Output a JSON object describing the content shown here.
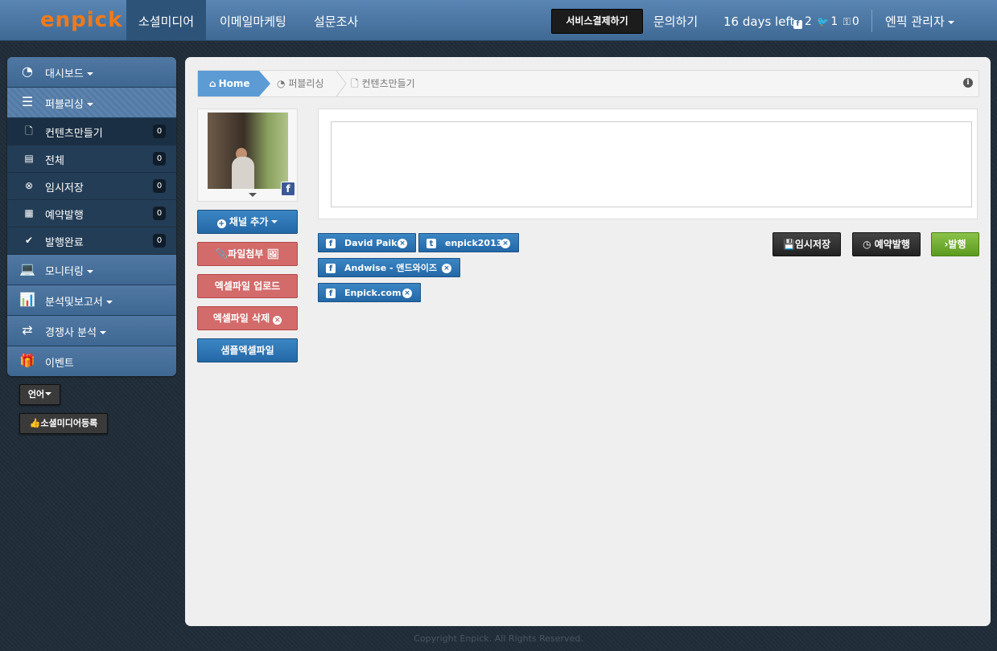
{
  "brand": {
    "logo_text": "enpick"
  },
  "topnav": {
    "tabs": [
      {
        "label": "소셜미디어",
        "active": true
      },
      {
        "label": "이메일마케팅",
        "active": false
      },
      {
        "label": "설문조사",
        "active": false
      }
    ],
    "pay_button": "서비스결제하기",
    "contact_link": "문의하기",
    "days_left": "16 days left",
    "stats": {
      "facebook": "2",
      "twitter": "1",
      "key": "0"
    },
    "user_menu": "엔픽 관리자"
  },
  "sidebar": {
    "items": [
      {
        "label": "대시보드",
        "icon": "dashboard-icon",
        "dropdown": true
      },
      {
        "label": "퍼블리싱",
        "icon": "list-icon",
        "dropdown": true,
        "open": true
      },
      {
        "label": "모니터링",
        "icon": "laptop-icon",
        "dropdown": true
      },
      {
        "label": "분석및보고서",
        "icon": "bar-chart-icon",
        "dropdown": true
      },
      {
        "label": "경쟁사 분석",
        "icon": "exchange-icon",
        "dropdown": true
      },
      {
        "label": "이벤트",
        "icon": "gift-icon",
        "dropdown": false
      }
    ],
    "subitems": [
      {
        "label": "컨텐츠만들기",
        "count": "0",
        "icon": "file-icon",
        "active": true
      },
      {
        "label": "전체",
        "count": "0",
        "icon": "list-alt-icon"
      },
      {
        "label": "임시저장",
        "count": "0",
        "icon": "times-circle-icon"
      },
      {
        "label": "예약발행",
        "count": "0",
        "icon": "calendar-icon"
      },
      {
        "label": "발행완료",
        "count": "0",
        "icon": "check-icon"
      }
    ],
    "language_button": "언어",
    "register_button": "소셜미디어등록"
  },
  "breadcrumb": {
    "home": "Home",
    "level1": "퍼블리싱",
    "level2": "컨텐츠만들기"
  },
  "left_buttons": {
    "add_channel": "채널 추가",
    "attach_file": "파일첨부",
    "excel_upload": "엑셀파일 업로드",
    "excel_delete": "엑셀파일 삭제",
    "sample_excel": "샘플엑셀파일"
  },
  "editor": {
    "value": "",
    "placeholder": ""
  },
  "channels": [
    {
      "network": "facebook",
      "name": "David Paik"
    },
    {
      "network": "twitter",
      "name": "enpick2013"
    },
    {
      "network": "facebook",
      "name": "Andwise - 앤드와이즈"
    },
    {
      "network": "facebook",
      "name": "Enpick.com"
    }
  ],
  "actions": {
    "save_draft": "임시저장",
    "schedule": "예약발행",
    "publish": "발행"
  },
  "colors": {
    "topbar": "#4a76a4",
    "accent_blue": "#2468a6",
    "publish_green": "#6aab2a",
    "attach_red": "#d36b6b",
    "logo_orange": "#f07a1a"
  },
  "footer": "Copyright Enpick. All Rights Reserved."
}
